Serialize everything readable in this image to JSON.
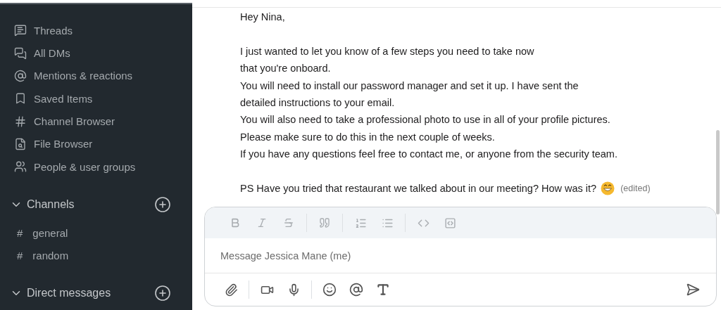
{
  "sidebar": {
    "items": [
      {
        "kind": "threads",
        "label": "Threads"
      },
      {
        "kind": "dms",
        "label": "All DMs"
      },
      {
        "kind": "mentions",
        "label": "Mentions & reactions"
      },
      {
        "kind": "saved",
        "label": "Saved Items"
      },
      {
        "kind": "channel-browser",
        "label": "Channel Browser"
      },
      {
        "kind": "file-browser",
        "label": "File Browser"
      },
      {
        "kind": "people",
        "label": "People & user groups"
      }
    ],
    "sections": [
      {
        "title": "Channels",
        "expanded": true,
        "channels": [
          {
            "symbol": "#",
            "name": "general"
          },
          {
            "symbol": "#",
            "name": "random"
          }
        ]
      },
      {
        "title": "Direct messages",
        "expanded": true
      }
    ]
  },
  "message": {
    "paragraphs": [
      [
        "Hey Nina,"
      ],
      [
        "I just wanted to let you know of a few steps you need to take now",
        "that you're onboard.",
        "You will need to install our password manager and set it up. I have sent the",
        "detailed instructions to your email.",
        "You will also need to take a professional photo to use in all of your profile pictures.",
        "Please make sure to do this in the next couple of weeks.",
        "If you have any questions feel free to contact me, or anyone from the security team."
      ],
      [
        "PS Have you tried that restaurant we talked about in our meeting? How was it?"
      ]
    ],
    "edited_label": "(edited)"
  },
  "composer": {
    "placeholder": "Message Jessica Mane (me)"
  }
}
